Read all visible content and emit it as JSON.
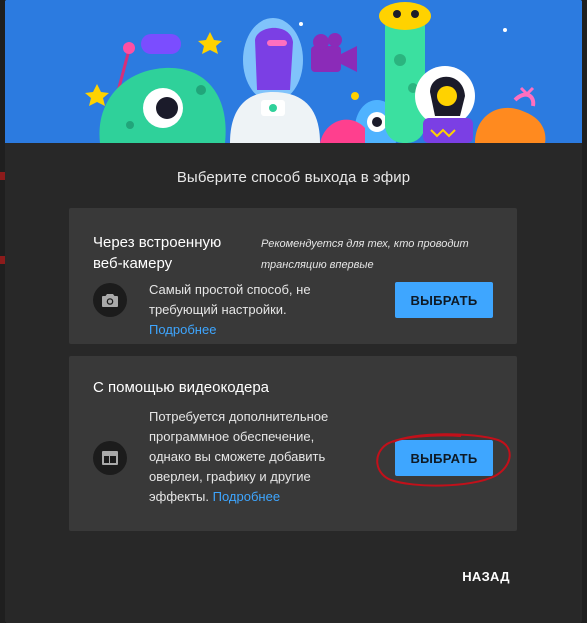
{
  "dialog": {
    "heading": "Выберите способ выхода в эфир",
    "back_label": "НАЗАД"
  },
  "webcam_option": {
    "title": "Через встроенную веб-камеру",
    "recommendation": "Рекомендуется для тех, кто проводит трансляцию впервые",
    "description": "Самый простой способ, не требующий настройки.",
    "more_link": "Подробнее",
    "button_label": "ВЫБРАТЬ",
    "icon": "camera-icon"
  },
  "encoder_option": {
    "title": "С помощью видеокодера",
    "description": "Потребуется дополнительное программное обеспечение, однако вы сможете добавить оверлеи, графику и другие эффекты.",
    "more_link": "Подробнее",
    "button_label": "ВЫБРАТЬ",
    "icon": "encoder-window-icon"
  },
  "colors": {
    "accent": "#3ea6ff",
    "annotation": "#c2101a",
    "dialog_bg": "#282828",
    "card_bg": "#393939"
  }
}
